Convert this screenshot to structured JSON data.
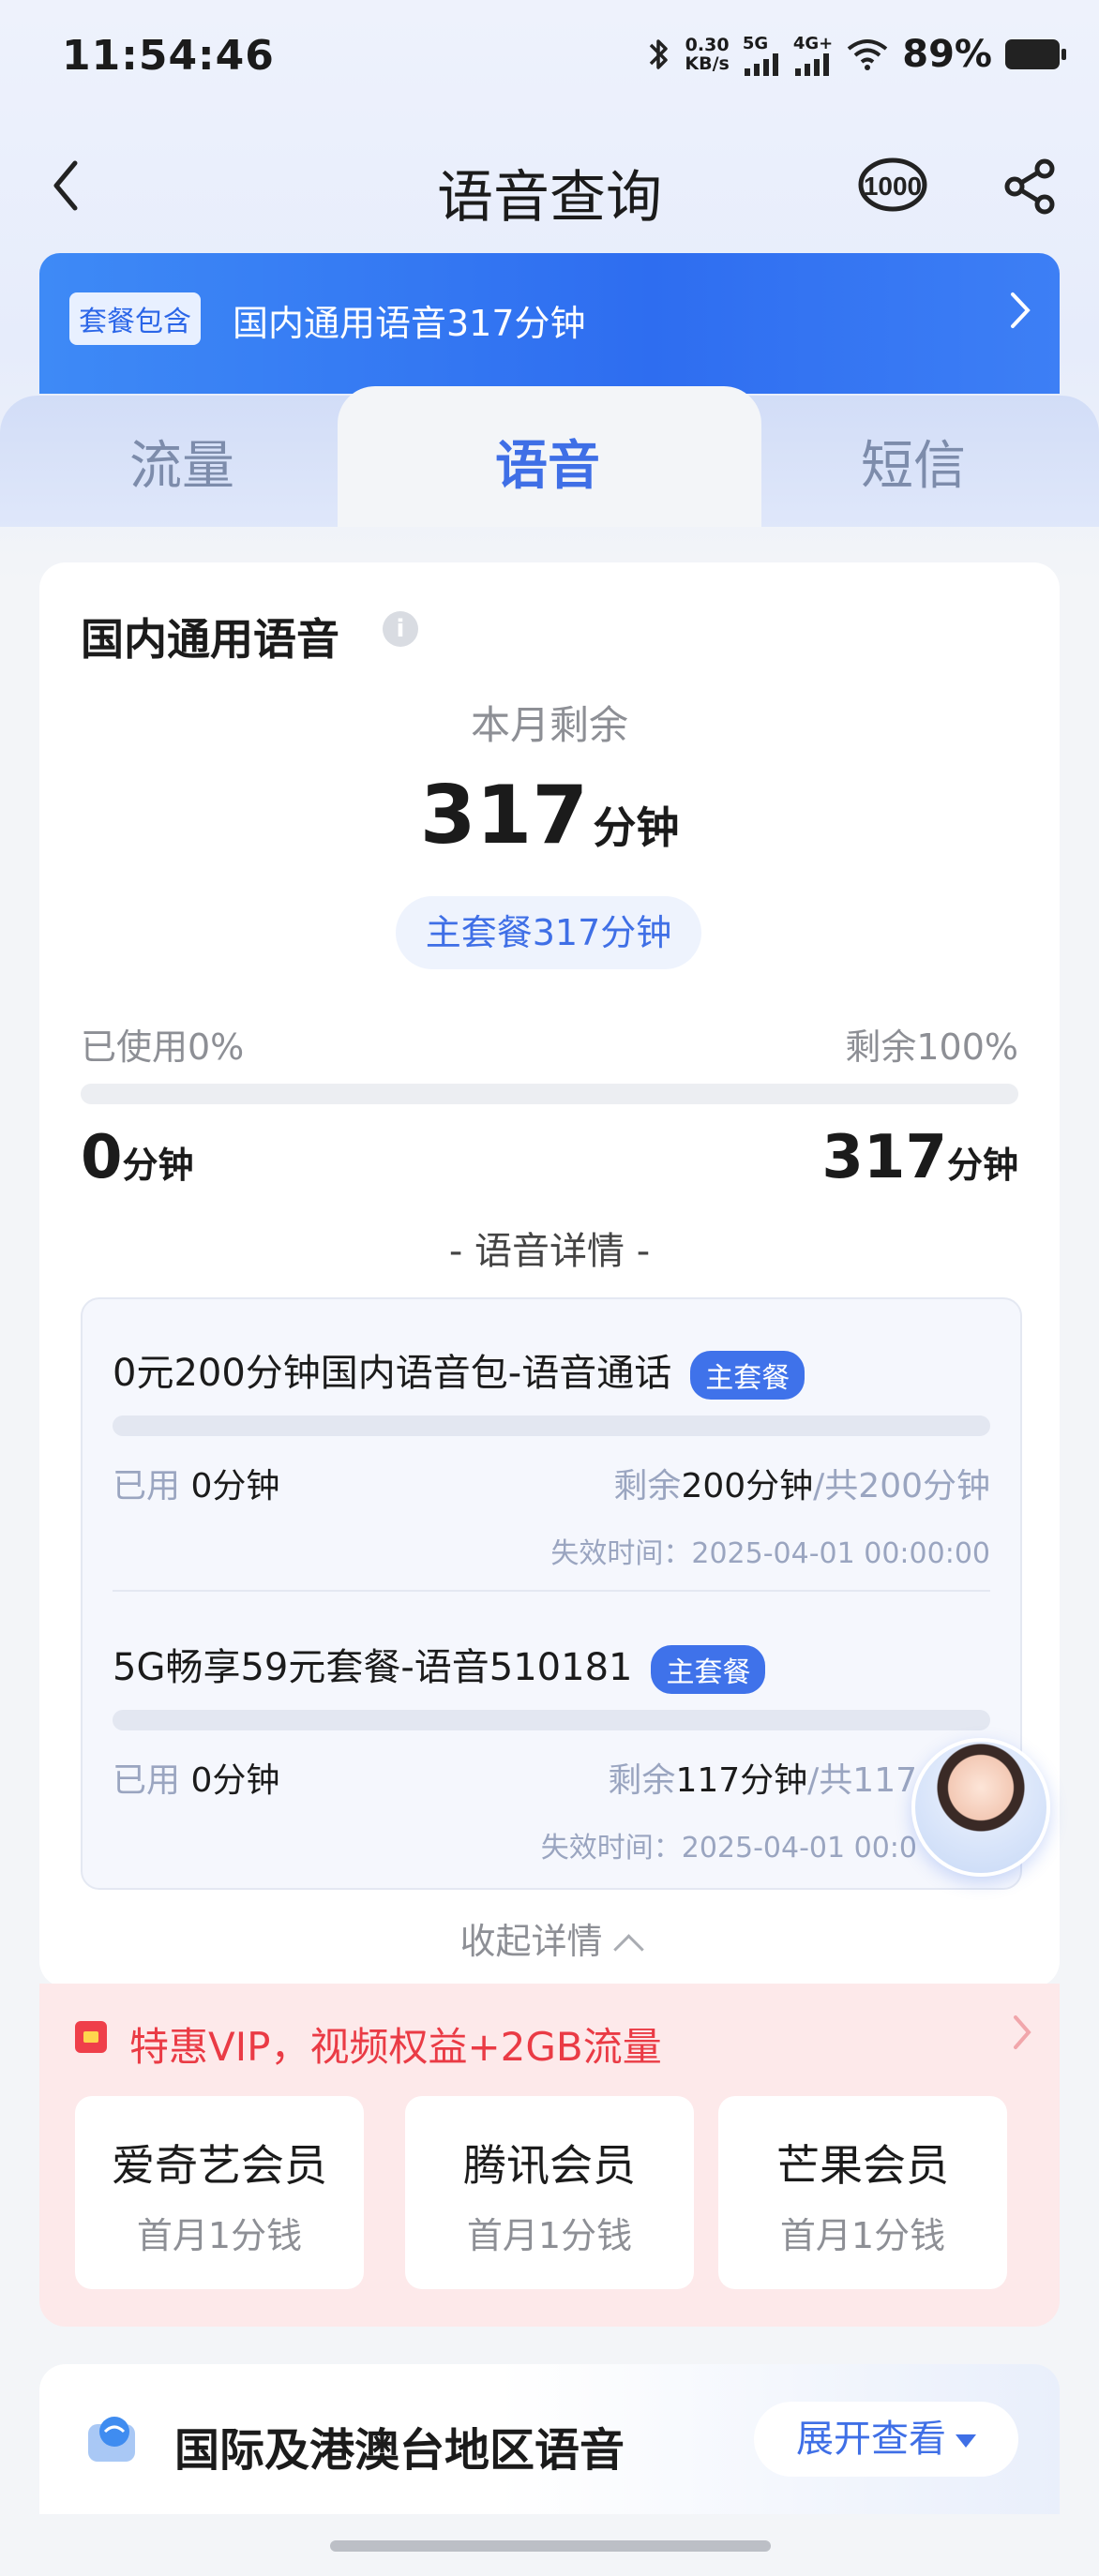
{
  "status_bar": {
    "time": "11:54:46",
    "net_speed_value": "0.30",
    "net_speed_unit": "KB/s",
    "sig1": "5G",
    "sig2": "4G+",
    "battery": "89%"
  },
  "nav": {
    "title": "语音查询",
    "service_icon": "10000-service-icon",
    "share_icon": "share-icon"
  },
  "banner": {
    "badge": "套餐包含",
    "text": "国内通用语音317分钟"
  },
  "tabs": [
    {
      "label": "流量",
      "active": false
    },
    {
      "label": "语音",
      "active": true
    },
    {
      "label": "短信",
      "active": false
    }
  ],
  "summary": {
    "title": "国内通用语音",
    "remain_label": "本月剩余",
    "remain_value": "317",
    "remain_unit": "分钟",
    "plan_pill": "主套餐317分钟",
    "used_pct_label": "已使用0%",
    "remain_pct_label": "剩余100%",
    "used_fraction": 0,
    "used_value": "0",
    "used_unit": "分钟",
    "remain_amount": "317",
    "remain_amount_unit": "分钟",
    "detail_heading": "- 语音详情 -",
    "collapse_label": "收起详情"
  },
  "details": [
    {
      "name": "0元200分钟国内语音包-语音通话",
      "badge": "主套餐",
      "used_label": "已用",
      "used_value": "0分钟",
      "remain_label": "剩余",
      "remain_value": "200分钟",
      "total": "/共200分钟",
      "expire": "失效时间：2025-04-01 00:00:00"
    },
    {
      "name": "5G畅享59元套餐-语音510181",
      "badge": "主套餐",
      "used_label": "已用",
      "used_value": "0分钟",
      "remain_label": "剩余",
      "remain_value": "117分钟",
      "total": "/共117",
      "expire": "失效时间：2025-04-01 00:0"
    }
  ],
  "vip": {
    "text": "特惠VIP，视频权益+2GB流量",
    "cards": [
      {
        "name": "爱奇艺会员",
        "sub": "首月1分钱"
      },
      {
        "name": "腾讯会员",
        "sub": "首月1分钱"
      },
      {
        "name": "芒果会员",
        "sub": "首月1分钱"
      }
    ]
  },
  "intl": {
    "text": "国际及港澳台地区语音",
    "button": "展开查看"
  },
  "colors": {
    "accent": "#3f6fe6",
    "banner": "#2e6df0",
    "vip_red": "#ea3b45",
    "vip_bg": "#fde9ea"
  }
}
